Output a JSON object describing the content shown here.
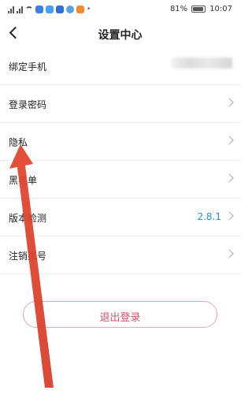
{
  "status_bar": {
    "battery": "81%",
    "time": "10:07"
  },
  "header": {
    "title": "设置中心"
  },
  "settings": {
    "bind_phone": "绑定手机",
    "login_password": "登录密码",
    "privacy": "隐私",
    "blacklist": "黑名单",
    "version_check": "版本检测",
    "version_value": "2.8.1",
    "cancel_account": "注销账号"
  },
  "actions": {
    "logout_label": "退出登录"
  },
  "colors": {
    "accent_blue": "#2a8fd8",
    "logout_text": "#d9506a",
    "logout_border": "#e9a7b4",
    "annotation_arrow": "#e2462f"
  },
  "icons": {
    "back": "chevron-left-icon",
    "row_arrow": "chevron-right-icon"
  }
}
